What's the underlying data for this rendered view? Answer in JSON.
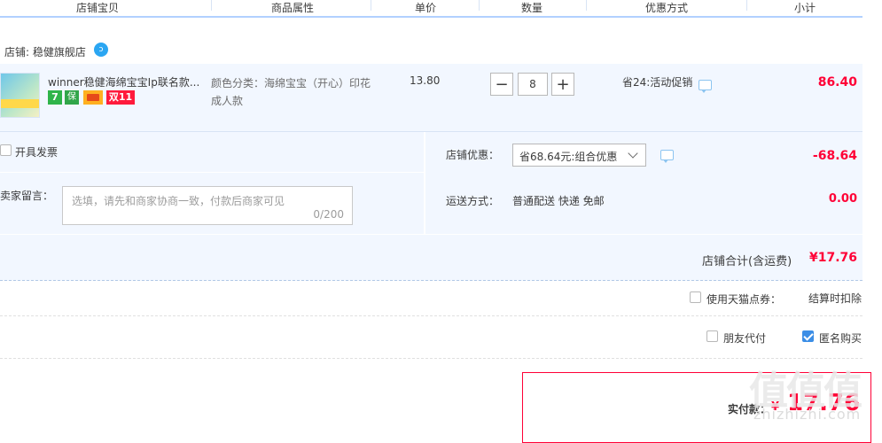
{
  "header": {
    "columns": [
      "店铺宝贝",
      "商品属性",
      "单价",
      "数量",
      "优惠方式",
      "小计"
    ]
  },
  "shop": {
    "label": "店铺: 稳健旗舰店",
    "icon": "chat-bubble-icon"
  },
  "item": {
    "title": "winner稳健海绵宝宝Ip联名款...",
    "badges": [
      "7",
      "保",
      "card",
      "双11"
    ],
    "attribute": "颜色分类：海绵宝宝（开心）印花成人款",
    "price": "13.80",
    "quantity": "8",
    "qty_minus": "−",
    "qty_plus": "+",
    "promotion": "省24:活动促销",
    "subtotal": "86.40"
  },
  "extras": {
    "invoice_label": "开具发票",
    "message_label": "给卖家留言：",
    "message_placeholder": "选填，请先和商家协商一致，付款后商家可见",
    "message_count": "0/200",
    "shop_discount_label": "店铺优惠：",
    "shop_discount_selected": "省68.64元:组合优惠",
    "shop_discount_value": "-68.64",
    "shipping_label": "运送方式：",
    "shipping_value": "普通配送 快递 免邮",
    "shipping_cost": "0.00"
  },
  "shop_total": {
    "label": "店铺合计(含运费)",
    "value": "¥17.76"
  },
  "options": {
    "tmall_points_label": "使用天猫点券：",
    "tmall_points_value": "结算时扣除",
    "friend_pay_label": "朋友代付",
    "friend_pay_checked": false,
    "anonymous_label": "匿名购买",
    "anonymous_checked": true
  },
  "payment": {
    "label": "实付款：",
    "currency": "¥",
    "value": "17.76"
  },
  "watermark": {
    "logo": "值值值",
    "site": "zhizhizhi.com"
  },
  "colors": {
    "accent_red": "#ff0036",
    "row_bg": "#f2f7ff",
    "header_line": "#b2d1ff"
  }
}
